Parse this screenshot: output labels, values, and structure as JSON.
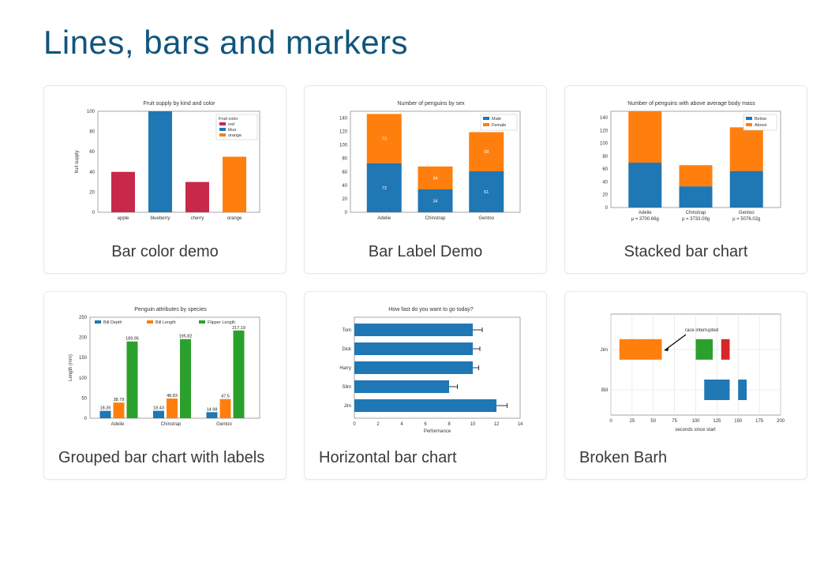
{
  "heading": "Lines, bars and markers",
  "cards": [
    {
      "caption": "Bar color demo"
    },
    {
      "caption": "Bar Label Demo"
    },
    {
      "caption": "Stacked bar chart"
    },
    {
      "caption": "Grouped bar chart with labels"
    },
    {
      "caption": "Horizontal bar chart"
    },
    {
      "caption": "Broken Barh"
    }
  ],
  "chart_data": [
    {
      "type": "bar",
      "title": "Fruit supply by kind and color",
      "xlabel": "",
      "ylabel": "fruit supply",
      "yticks": [
        0,
        20,
        40,
        60,
        80,
        100
      ],
      "ylim": [
        0,
        100
      ],
      "categories": [
        "apple",
        "blueberry",
        "cherry",
        "orange"
      ],
      "values": [
        40,
        100,
        30,
        55
      ],
      "bar_colors": [
        "red",
        "blue",
        "red",
        "orange"
      ],
      "legend_title": "Fruit color",
      "legend_entries": [
        "red",
        "blue",
        "orange"
      ]
    },
    {
      "type": "bar_stacked_labeled",
      "title": "Number of penguins by sex",
      "yticks": [
        0,
        20,
        40,
        60,
        80,
        100,
        120,
        140
      ],
      "ylim": [
        0,
        150
      ],
      "categories": [
        "Adelie",
        "Chinstrap",
        "Gentoo"
      ],
      "series": [
        {
          "name": "Male",
          "values": [
            73,
            34,
            61
          ],
          "color": "#1f77b4"
        },
        {
          "name": "Female",
          "values": [
            73,
            34,
            58
          ],
          "color": "#ff7f0e"
        }
      ]
    },
    {
      "type": "bar_stacked",
      "title": "Number of penguins with above average body mass",
      "yticks": [
        0,
        20,
        40,
        60,
        80,
        100,
        120,
        140
      ],
      "ylim": [
        0,
        150
      ],
      "categories": [
        "Adelie",
        "Chinstrap",
        "Gentoo"
      ],
      "sublabels": [
        "μ = 3700.66g",
        "μ = 3733.09g",
        "μ = 5076.02g"
      ],
      "series": [
        {
          "name": "Below",
          "values": [
            70,
            33,
            57
          ],
          "color": "#1f77b4"
        },
        {
          "name": "Above",
          "values": [
            80,
            33,
            68
          ],
          "color": "#ff7f0e"
        }
      ]
    },
    {
      "type": "bar_grouped",
      "title": "Penguin attributes by species",
      "ylabel": "Length (mm)",
      "yticks": [
        0,
        50,
        100,
        150,
        200,
        250
      ],
      "ylim": [
        0,
        250
      ],
      "categories": [
        "Adelie",
        "Chinstrap",
        "Gentoo"
      ],
      "series": [
        {
          "name": "Bill Depth",
          "values": [
            18.35,
            18.43,
            14.98
          ],
          "color": "#1f77b4"
        },
        {
          "name": "Bill Length",
          "values": [
            38.79,
            48.83,
            47.5
          ],
          "color": "#ff7f0e"
        },
        {
          "name": "Flipper Length",
          "values": [
            189.95,
            195.82,
            217.19
          ],
          "color": "#2ca02c"
        }
      ]
    },
    {
      "type": "barh",
      "title": "How fast do you want to go today?",
      "xlabel": "Performance",
      "xticks": [
        0,
        2,
        4,
        6,
        8,
        10,
        12,
        14
      ],
      "xlim": [
        0,
        14
      ],
      "categories": [
        "Tom",
        "Dick",
        "Harry",
        "Slim",
        "Jim"
      ],
      "values": [
        10,
        10,
        10,
        8,
        12
      ],
      "xerr": [
        0.8,
        0.6,
        0.5,
        0.7,
        0.9
      ],
      "color": "#1f77b4"
    },
    {
      "type": "broken_barh",
      "title": "",
      "xlabel": "seconds since start",
      "xticks": [
        0,
        25,
        50,
        75,
        100,
        125,
        150,
        175,
        200
      ],
      "xlim": [
        0,
        200
      ],
      "ylabels": [
        "Bill",
        "Jim"
      ],
      "rows": [
        {
          "y": "Bill",
          "segments": [
            {
              "x0": 110,
              "width": 30,
              "color": "#1f77b4"
            },
            {
              "x0": 150,
              "width": 10,
              "color": "#1f77b4"
            }
          ]
        },
        {
          "y": "Jim",
          "segments": [
            {
              "x0": 10,
              "width": 50,
              "color": "#ff7f0e"
            },
            {
              "x0": 100,
              "width": 20,
              "color": "#2ca02c"
            },
            {
              "x0": 130,
              "width": 10,
              "color": "#d62728"
            }
          ]
        }
      ],
      "annotation": {
        "text": "race interrupted",
        "target_x": 60,
        "target_row": "Jim"
      }
    }
  ]
}
